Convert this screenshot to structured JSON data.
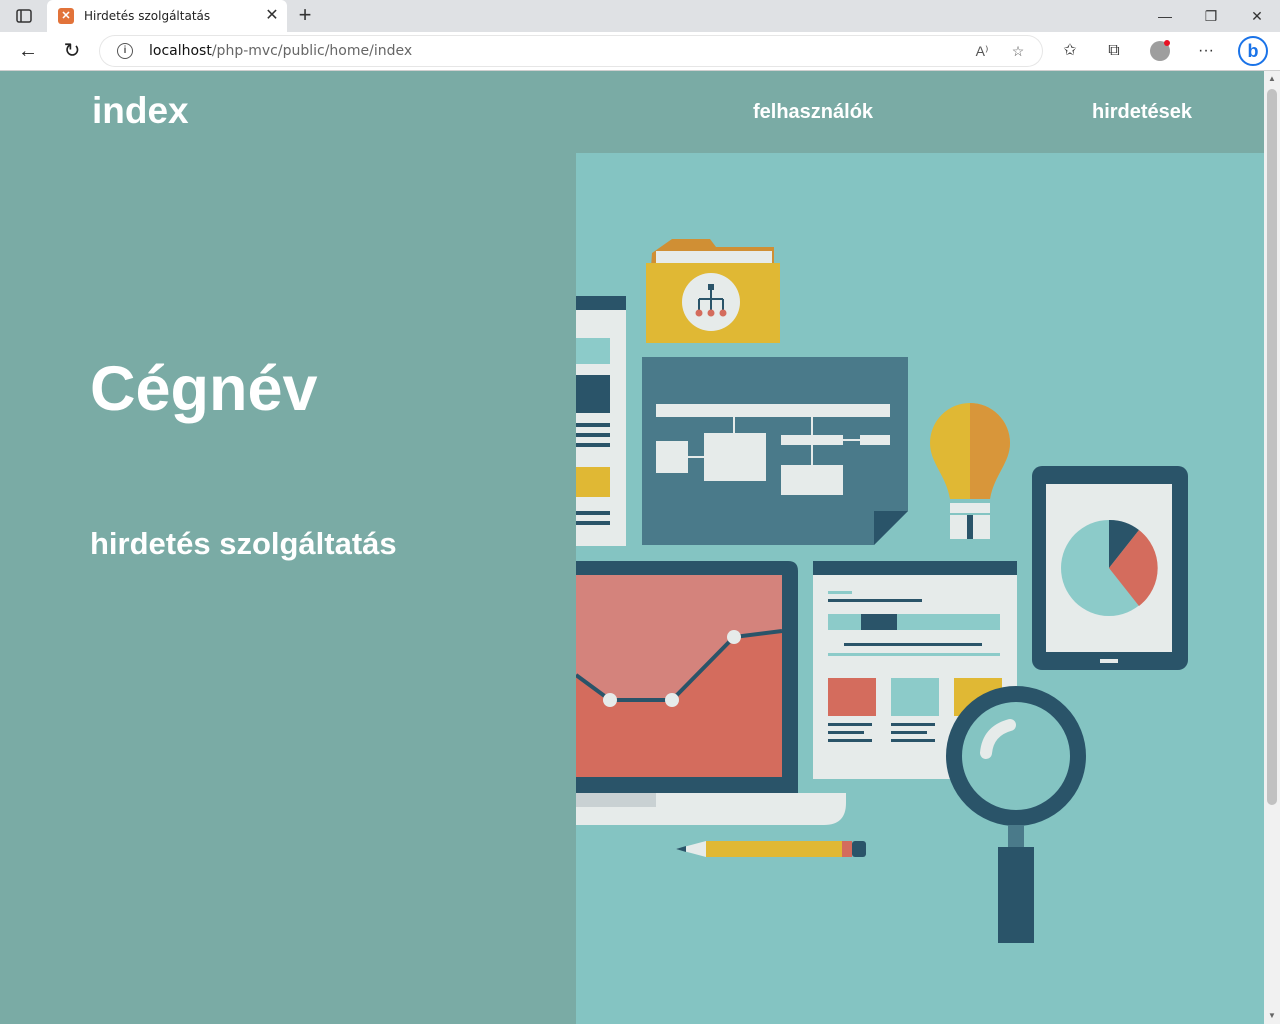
{
  "browser": {
    "tab": {
      "title": "Hirdetés szolgáltatás",
      "favicon": "xampp-favicon-icon"
    },
    "address": {
      "host": "localhost",
      "path": "/php-mvc/public/home/index"
    }
  },
  "header": {
    "brand": "index",
    "nav": [
      {
        "label": "felhasználók"
      },
      {
        "label": "hirdetések"
      }
    ]
  },
  "hero": {
    "title": "Cégnév",
    "subtitle": "hirdetés szolgáltatás"
  },
  "colors": {
    "page_bg": "#7aaba5",
    "illustration_bg": "#84c4c2",
    "dark_teal": "#2a5469",
    "yellow": "#e0b834",
    "coral": "#d46c5d"
  }
}
